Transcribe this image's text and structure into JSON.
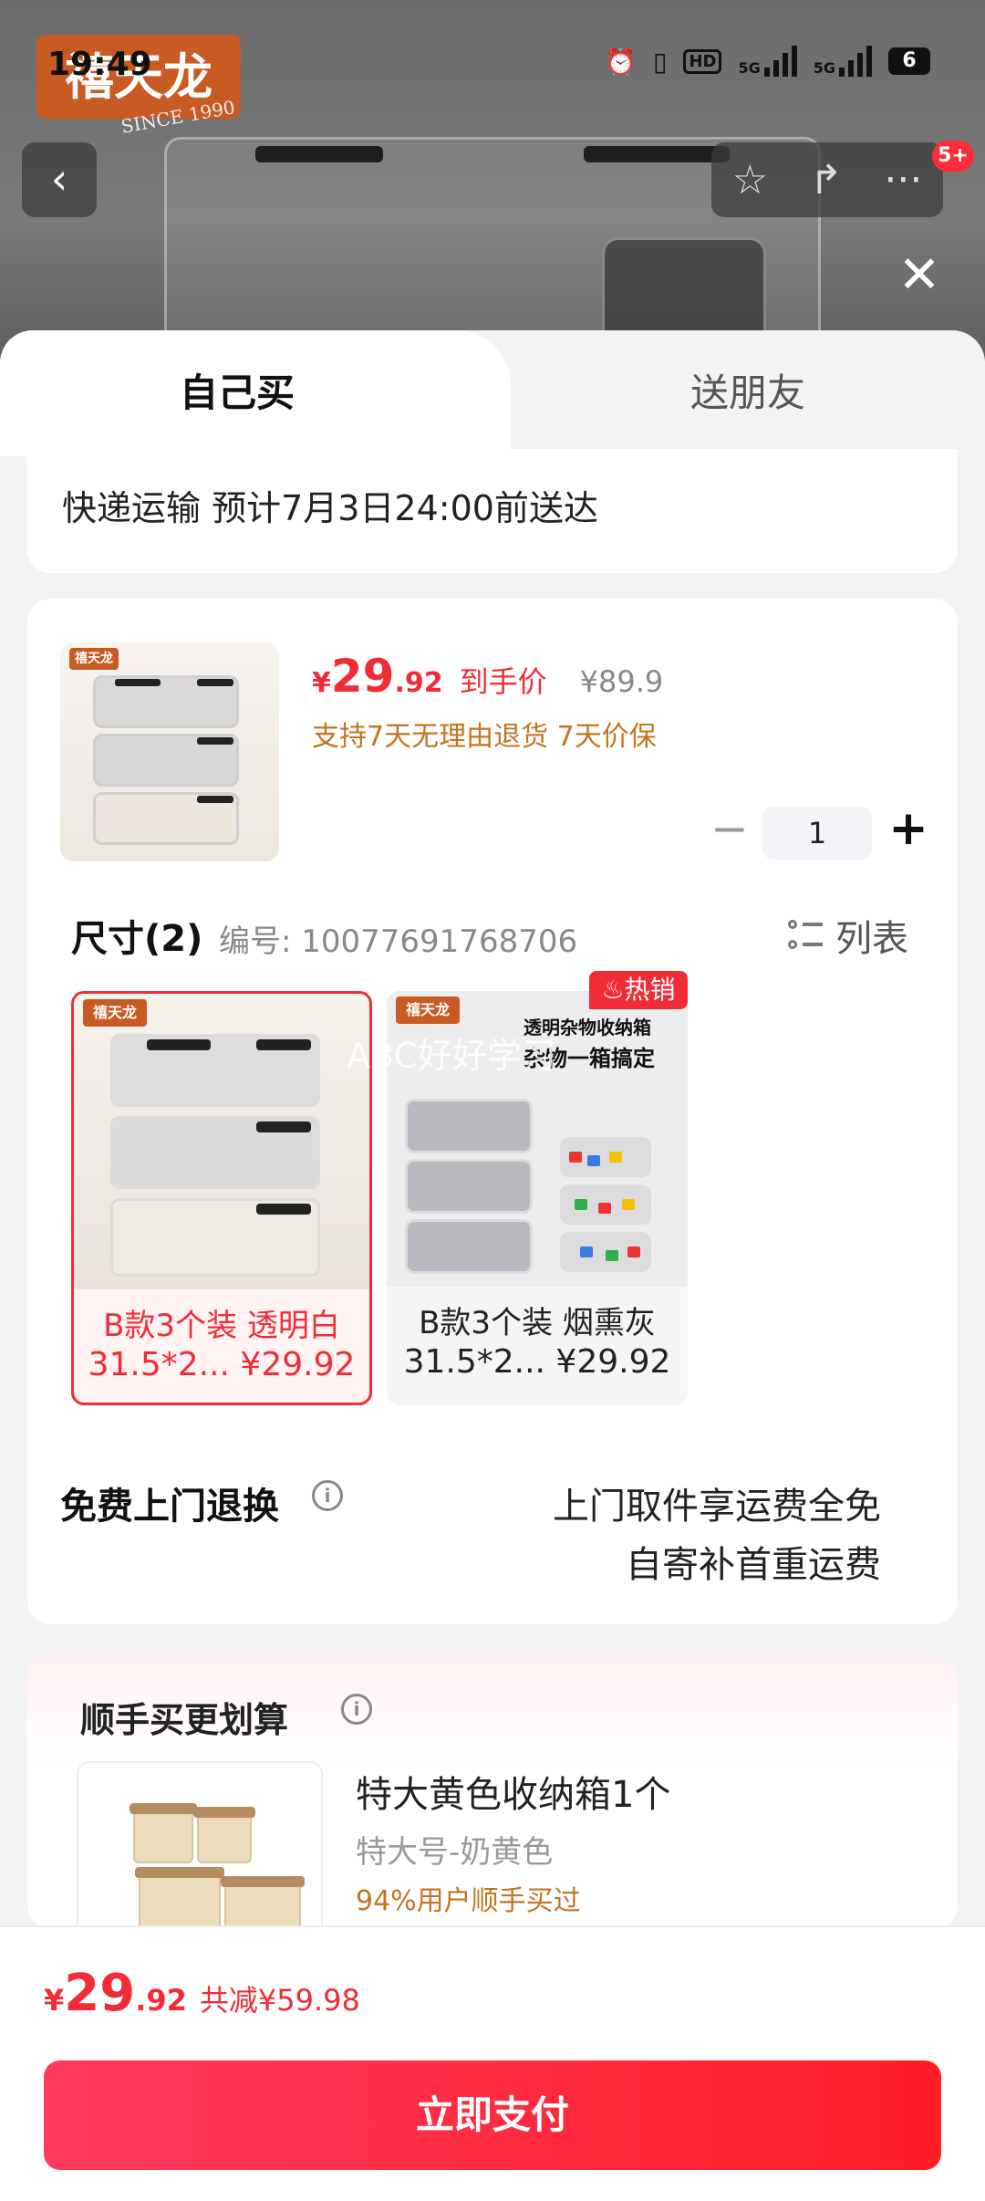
{
  "status_bar": {
    "time": "19:49",
    "network_1": "5G",
    "network_2": "5G",
    "battery": "6"
  },
  "background": {
    "brand_logo": "禧天龙",
    "brand_since": "SINCE 1990",
    "cart_badge": "5+"
  },
  "tabs": {
    "self_buy": "自己买",
    "gift_friend": "送朋友"
  },
  "shipping": {
    "text": "快递运输 预计7月3日24:00前送达"
  },
  "product": {
    "currency": "¥",
    "price_int": "29",
    "price_dec": ".92",
    "price_label": "到手价",
    "original_price": "¥89.9",
    "guarantee": "支持7天无理由退货  7天价保",
    "quantity": "1",
    "thumb_logo": "禧天龙"
  },
  "size": {
    "title": "尺寸(2)",
    "code": "编号: 10077691768706",
    "list_label": "列表",
    "variants": [
      {
        "name": "B款3个装 透明白",
        "spec": "31.5*2... ¥29.92",
        "selected": true
      },
      {
        "name": "B款3个装 烟熏灰",
        "spec": "31.5*2... ¥29.92",
        "selected": false
      }
    ],
    "hot_tag": "热销",
    "variant2_headline": "透明杂物收纳箱",
    "variant2_sub": "杂物一箱搞定",
    "watermark": "ABC好好学习"
  },
  "returns": {
    "title": "免费上门退换",
    "line1": "上门取件享运费全免",
    "line2": "自寄补首重运费"
  },
  "addon": {
    "title": "顺手买更划算",
    "name": "特大黄色收纳箱1个",
    "spec": "特大号-奶黄色",
    "hint": "94%用户顺手买过"
  },
  "footer": {
    "currency": "¥",
    "price_int": "29",
    "price_dec": ".92",
    "savings": "共减¥59.98",
    "pay_button": "立即支付"
  },
  "colors": {
    "accent_red": "#f22c36",
    "guarantee_orange": "#c4741f"
  }
}
